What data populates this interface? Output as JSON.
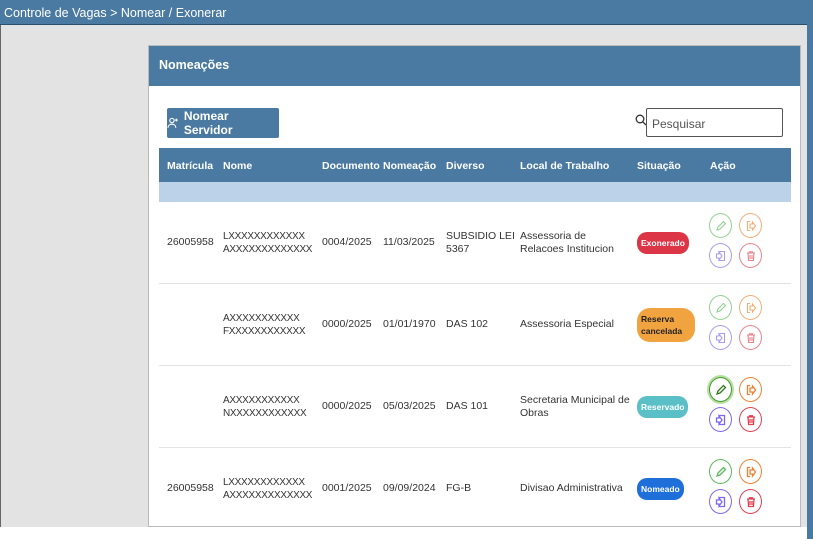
{
  "breadcrumb": "Controle de Vagas > Nomear / Exonerar",
  "panel": {
    "title": "Nomeações"
  },
  "toolbar": {
    "nomear_label": "Nomear Servidor"
  },
  "search": {
    "placeholder": "Pesquisar"
  },
  "table": {
    "headers": [
      "Matrícula",
      "Nome",
      "Documento",
      "Nomeação",
      "Diverso",
      "Local de Trabalho",
      "Situação",
      "Ação"
    ],
    "rows": [
      {
        "matricula": "26005958",
        "nome": "LXXXXXXXXXXXX AXXXXXXXXXXXXX",
        "documento": "0004/2025",
        "nomeacao": "11/03/2025",
        "diverso": "SUBSIDIO LEI 5367",
        "local": "Assessoria de Relacoes Institucion",
        "situacao": "Exonerado"
      },
      {
        "matricula": "",
        "nome": "AXXXXXXXXXXX FXXXXXXXXXXXX",
        "documento": "0000/2025",
        "nomeacao": "01/01/1970",
        "diverso": "DAS 102",
        "local": "Assessoria Especial",
        "situacao": "Reserva cancelada"
      },
      {
        "matricula": "",
        "nome": "AXXXXXXXXXXX NXXXXXXXXXXXX",
        "documento": "0000/2025",
        "nomeacao": "05/03/2025",
        "diverso": "DAS 101",
        "local": "Secretaria Municipal de Obras",
        "situacao": "Reservado"
      },
      {
        "matricula": "26005958",
        "nome": "LXXXXXXXXXXXX AXXXXXXXXXXXXX",
        "documento": "0001/2025",
        "nomeacao": "09/09/2024",
        "diverso": "FG-B",
        "local": "Divisao Administrativa",
        "situacao": "Nomeado"
      }
    ]
  },
  "icons": {
    "edit": "pencil-icon",
    "exonerate": "logout-icon",
    "nominate": "login-icon",
    "delete": "trash-icon",
    "search": "search-icon",
    "add_user": "add-user-icon"
  },
  "colors": {
    "header_bg": "#4a79a1",
    "exonerado": "#dc3545",
    "reserva_cancelada": "#f0a33f",
    "reservado": "#5bbfc8",
    "nomeado": "#1e6fd9"
  }
}
